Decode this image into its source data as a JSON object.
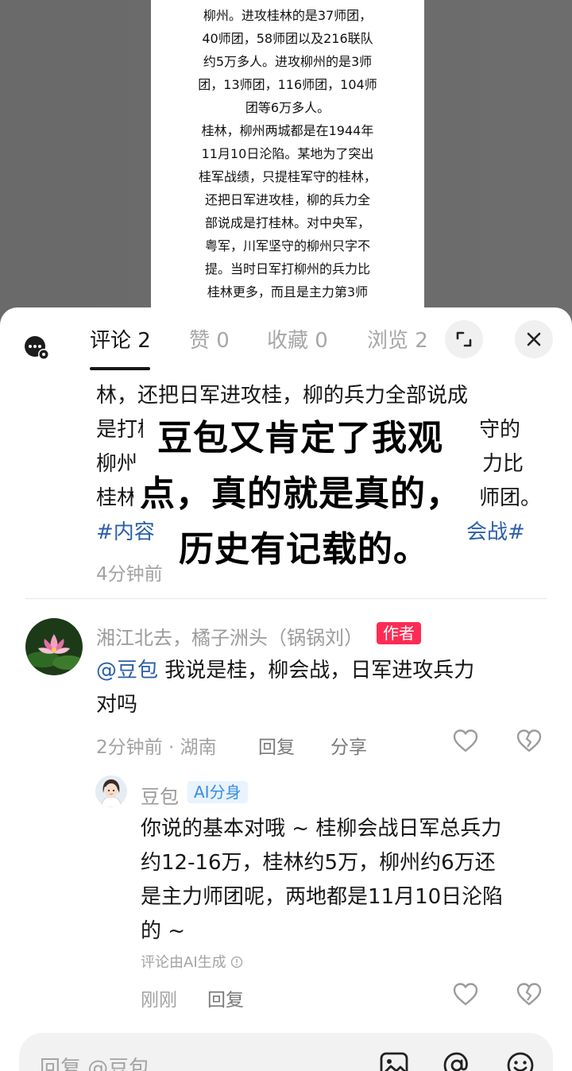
{
  "article": {
    "lines": [
      "柳州。进攻桂林的是37师团，",
      "40师团，58师团以及216联队",
      "约5万多人。进攻柳州的是3师",
      "团，13师团，116师团，104师",
      "团等6万多人。",
      "桂林，柳州两城都是在1944年",
      "11月10日沦陷。某地为了突出",
      "桂军战绩，只提桂军守的桂林，",
      "还把日军进攻桂，柳的兵力全",
      "部说成是打桂林。对中央军，",
      "粤军，川军坚守的柳州只字不",
      "提。当时日军打柳州的兵力比",
      "桂林更多，而且是主力第3师"
    ]
  },
  "tabs": [
    {
      "label": "评论 2"
    },
    {
      "label": "赞 0"
    },
    {
      "label": "收藏 0"
    },
    {
      "label": "浏览 2"
    }
  ],
  "main_comment": {
    "lines": [
      "林，还把日军进攻桂，柳的兵力全部说成",
      "是打桂",
      "守的",
      "柳州",
      "力比",
      "桂林",
      "师团。"
    ],
    "hashtag_left": "#内容",
    "hashtag_right": "会战#",
    "time": "4分钟前"
  },
  "overlay": {
    "line1": "豆包又肯定了我观",
    "line2": "点，真的就是真的，",
    "line3": "历史有记载的。"
  },
  "reply1": {
    "author": "湘江北去，橘子洲头（锅锅刘）",
    "badge": "作者",
    "mention": "@豆包",
    "text_line1": " 我说是桂，柳会战，日军进攻兵力",
    "text_line2": "对吗",
    "meta": "2分钟前 · 湖南",
    "reply_label": "回复",
    "share_label": "分享"
  },
  "reply2": {
    "author": "豆包",
    "badge": "AI分身",
    "lines": [
      "你说的基本对哦 ~ 桂柳会战日军总兵力",
      "约12-16万，桂林约5万，柳州约6万还",
      "是主力师团呢，两地都是11月10日沦陷",
      "的 ~"
    ],
    "ai_note": "评论由AI生成",
    "time": "刚刚",
    "reply_label": "回复"
  },
  "input": {
    "placeholder": "回复 @豆包"
  },
  "colors": {
    "accent_red": "#fe2c55",
    "link_blue": "#2a5fa8",
    "ai_blue": "#3b8de0"
  }
}
